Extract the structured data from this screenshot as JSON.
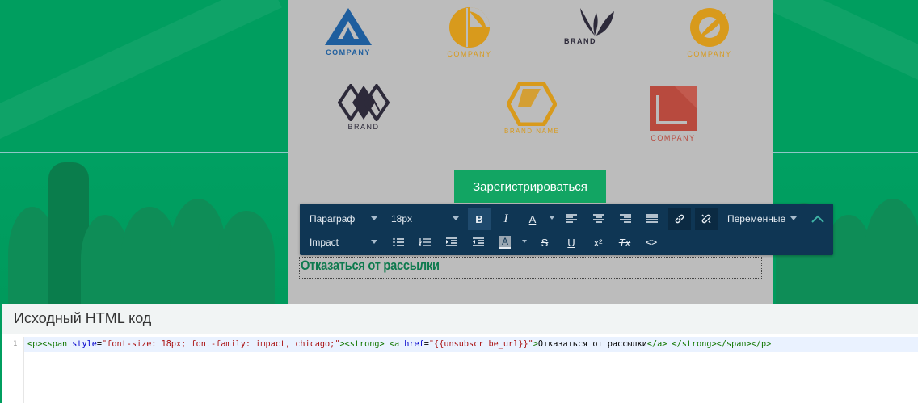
{
  "logos": [
    {
      "name": "company-logo-blue-triangle",
      "caption": "COMPANY",
      "color": "#1e5e9e"
    },
    {
      "name": "company-logo-orange-circle",
      "caption": "COMPANY",
      "color": "#d89a1c"
    },
    {
      "name": "brand-logo-leaves",
      "caption": "BRAND",
      "color": "#2d2a3a"
    },
    {
      "name": "company-logo-orange-ring",
      "caption": "COMPANY",
      "color": "#d89a1c"
    },
    {
      "name": "brand-logo-diamonds",
      "caption": "BRAND",
      "color": "#2d2a3a"
    },
    {
      "name": "brand-name-logo-hexagon",
      "caption": "BRAND NAME",
      "color": "#d89a1c"
    },
    {
      "name": "company-logo-red-square",
      "caption": "COMPANY",
      "color": "#b84a3e"
    }
  ],
  "cta": {
    "label": "Зарегистрироваться"
  },
  "toolbar": {
    "block_format": "Параграф",
    "font_size": "18px",
    "font_family": "Impact",
    "variables": "Переменные",
    "bold": "B",
    "italic": "I",
    "font_color": "A",
    "bg_color": "A",
    "strike": "S",
    "underline": "U",
    "superscript": "x²",
    "clear_format": "Tx",
    "code": "<>"
  },
  "editor": {
    "unsubscribe_text": "Отказаться от рассылки"
  },
  "source": {
    "title": "Исходный HTML код",
    "line_number": "1",
    "code_line": "<p><span style=\"font-size: 18px; font-family: impact, chicago;\"><strong> <a href=\"{{unsubscribe_url}}\">Отказаться от рассылки</a> </strong></span></p>"
  },
  "colors": {
    "brand_green": "#009e5f",
    "toolbar_bg": "#0f3654",
    "cta_green": "#12a563"
  }
}
